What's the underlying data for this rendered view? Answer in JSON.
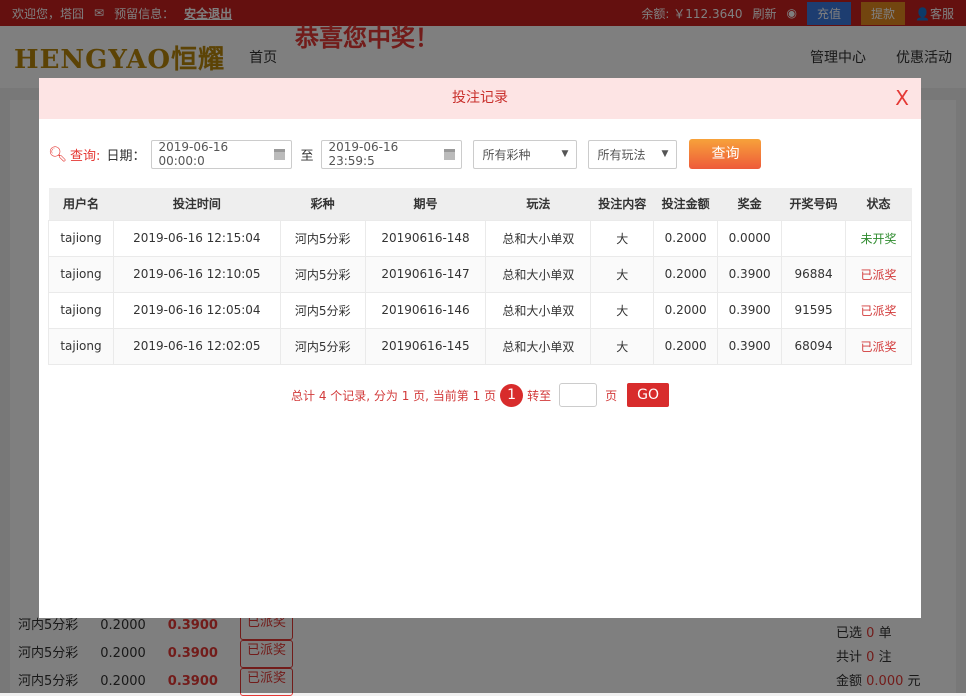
{
  "topbar": {
    "welcome": "欢迎您，塔囧",
    "notice": "预留信息：",
    "logout": "安全退出",
    "balance": "余额: ￥112.3640",
    "refresh": "刷新",
    "deposit": "充值",
    "withdraw": "提款",
    "service": "客服"
  },
  "nav": {
    "logo": "HENGYAO恒耀",
    "home": "首页",
    "manage": "管理中心",
    "promo": "优惠活动",
    "banner": "恭喜您中奖！"
  },
  "background": {
    "rows": [
      {
        "name": "河内5分彩",
        "amount": "0.2000",
        "bonus": "0.3900",
        "status": "已派奖"
      },
      {
        "name": "河内5分彩",
        "amount": "0.2000",
        "bonus": "0.3900",
        "status": "已派奖"
      },
      {
        "name": "河内5分彩",
        "amount": "0.2000",
        "bonus": "0.3900",
        "status": "已派奖"
      }
    ],
    "summary": {
      "selected_label": "已选",
      "selected": "0",
      "selected_unit": "单",
      "total_label": "共计",
      "total": "0",
      "total_unit": "注",
      "money_label": "金额",
      "money": "0.000",
      "money_unit": "元"
    }
  },
  "modal": {
    "title": "投注记录",
    "close": "X",
    "query": {
      "label": "查询:",
      "date_label": "日期：",
      "start": "2019-06-16 00:00:0",
      "to": "至",
      "end": "2019-06-16 23:59:5",
      "lottery": "所有彩种",
      "play": "所有玩法",
      "button": "查询"
    },
    "table": {
      "headers": [
        "用户名",
        "投注时间",
        "彩种",
        "期号",
        "玩法",
        "投注内容",
        "投注金额",
        "奖金",
        "开奖号码",
        "状态"
      ],
      "rows": [
        [
          "tajiong",
          "2019-06-16 12:15:04",
          "河内5分彩",
          "20190616-148",
          "总和大小单双",
          "大",
          "0.2000",
          "0.0000",
          "",
          "未开奖"
        ],
        [
          "tajiong",
          "2019-06-16 12:10:05",
          "河内5分彩",
          "20190616-147",
          "总和大小单双",
          "大",
          "0.2000",
          "0.3900",
          "96884",
          "已派奖"
        ],
        [
          "tajiong",
          "2019-06-16 12:05:04",
          "河内5分彩",
          "20190616-146",
          "总和大小单双",
          "大",
          "0.2000",
          "0.3900",
          "91595",
          "已派奖"
        ],
        [
          "tajiong",
          "2019-06-16 12:02:05",
          "河内5分彩",
          "20190616-145",
          "总和大小单双",
          "大",
          "0.2000",
          "0.3900",
          "68094",
          "已派奖"
        ]
      ]
    },
    "pager": {
      "summary": "总计 4 个记录, 分为 1 页, 当前第 1 页",
      "current": "1",
      "goto": "转至",
      "page_unit": "页",
      "go": "GO"
    }
  }
}
